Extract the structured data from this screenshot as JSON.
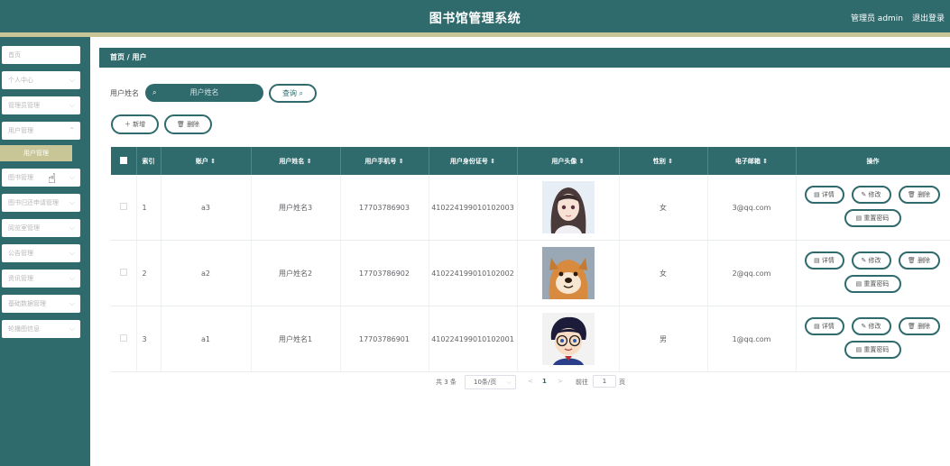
{
  "header": {
    "title": "图书馆管理系统",
    "user": "管理员 admin",
    "logout": "退出登录"
  },
  "sidebar": {
    "items": [
      {
        "label": "首页",
        "has_chevron": false
      },
      {
        "label": "个人中心",
        "has_chevron": true
      },
      {
        "label": "管理员管理",
        "has_chevron": true
      },
      {
        "label": "用户管理",
        "has_chevron": true
      },
      {
        "label": "图书管理",
        "has_chevron": true
      },
      {
        "label": "图书归还申请管理",
        "has_chevron": true
      },
      {
        "label": "阅览室管理",
        "has_chevron": true
      },
      {
        "label": "公告管理",
        "has_chevron": true
      },
      {
        "label": "资讯管理",
        "has_chevron": true
      },
      {
        "label": "基础数据管理",
        "has_chevron": true
      },
      {
        "label": "轮播图信息",
        "has_chevron": true
      }
    ],
    "active_sub": "用户管理"
  },
  "breadcrumb": "首页 / 用户",
  "search": {
    "label": "用户姓名",
    "placeholder": "用户姓名",
    "query_label": "查询"
  },
  "actions": {
    "add": "新增",
    "delete": "删除"
  },
  "table": {
    "headers": [
      "索引",
      "账户 ⇕",
      "用户姓名 ⇕",
      "用户手机号 ⇕",
      "用户身份证号 ⇕",
      "用户头像 ⇕",
      "性别 ⇕",
      "电子邮箱 ⇕",
      "操作"
    ],
    "rows": [
      {
        "index": "1",
        "account": "a3",
        "name": "用户姓名3",
        "phone": "17703786903",
        "id_card": "410224199010102003",
        "avatar": "anime-girl-portrait",
        "gender": "女",
        "email": "3@qq.com"
      },
      {
        "index": "2",
        "account": "a2",
        "name": "用户姓名2",
        "phone": "17703786902",
        "id_card": "410224199010102002",
        "avatar": "shiba-dog-photo",
        "gender": "女",
        "email": "2@qq.com"
      },
      {
        "index": "3",
        "account": "a1",
        "name": "用户姓名1",
        "phone": "17703786901",
        "id_card": "410224199010102001",
        "avatar": "anime-boy-glasses",
        "gender": "男",
        "email": "1@qq.com"
      }
    ],
    "row_actions": {
      "detail": "详情",
      "edit": "修改",
      "delete": "删除",
      "reset_password": "重置密码"
    }
  },
  "pagination": {
    "total": "共 3 条",
    "page_size": "10条/页",
    "prev": "<",
    "current_page": "1",
    "next": ">",
    "goto_label": "前往",
    "goto_value": "1",
    "page_suffix": "页"
  },
  "colors": {
    "primary": "#2f6a6d",
    "accent": "#c8c596"
  }
}
